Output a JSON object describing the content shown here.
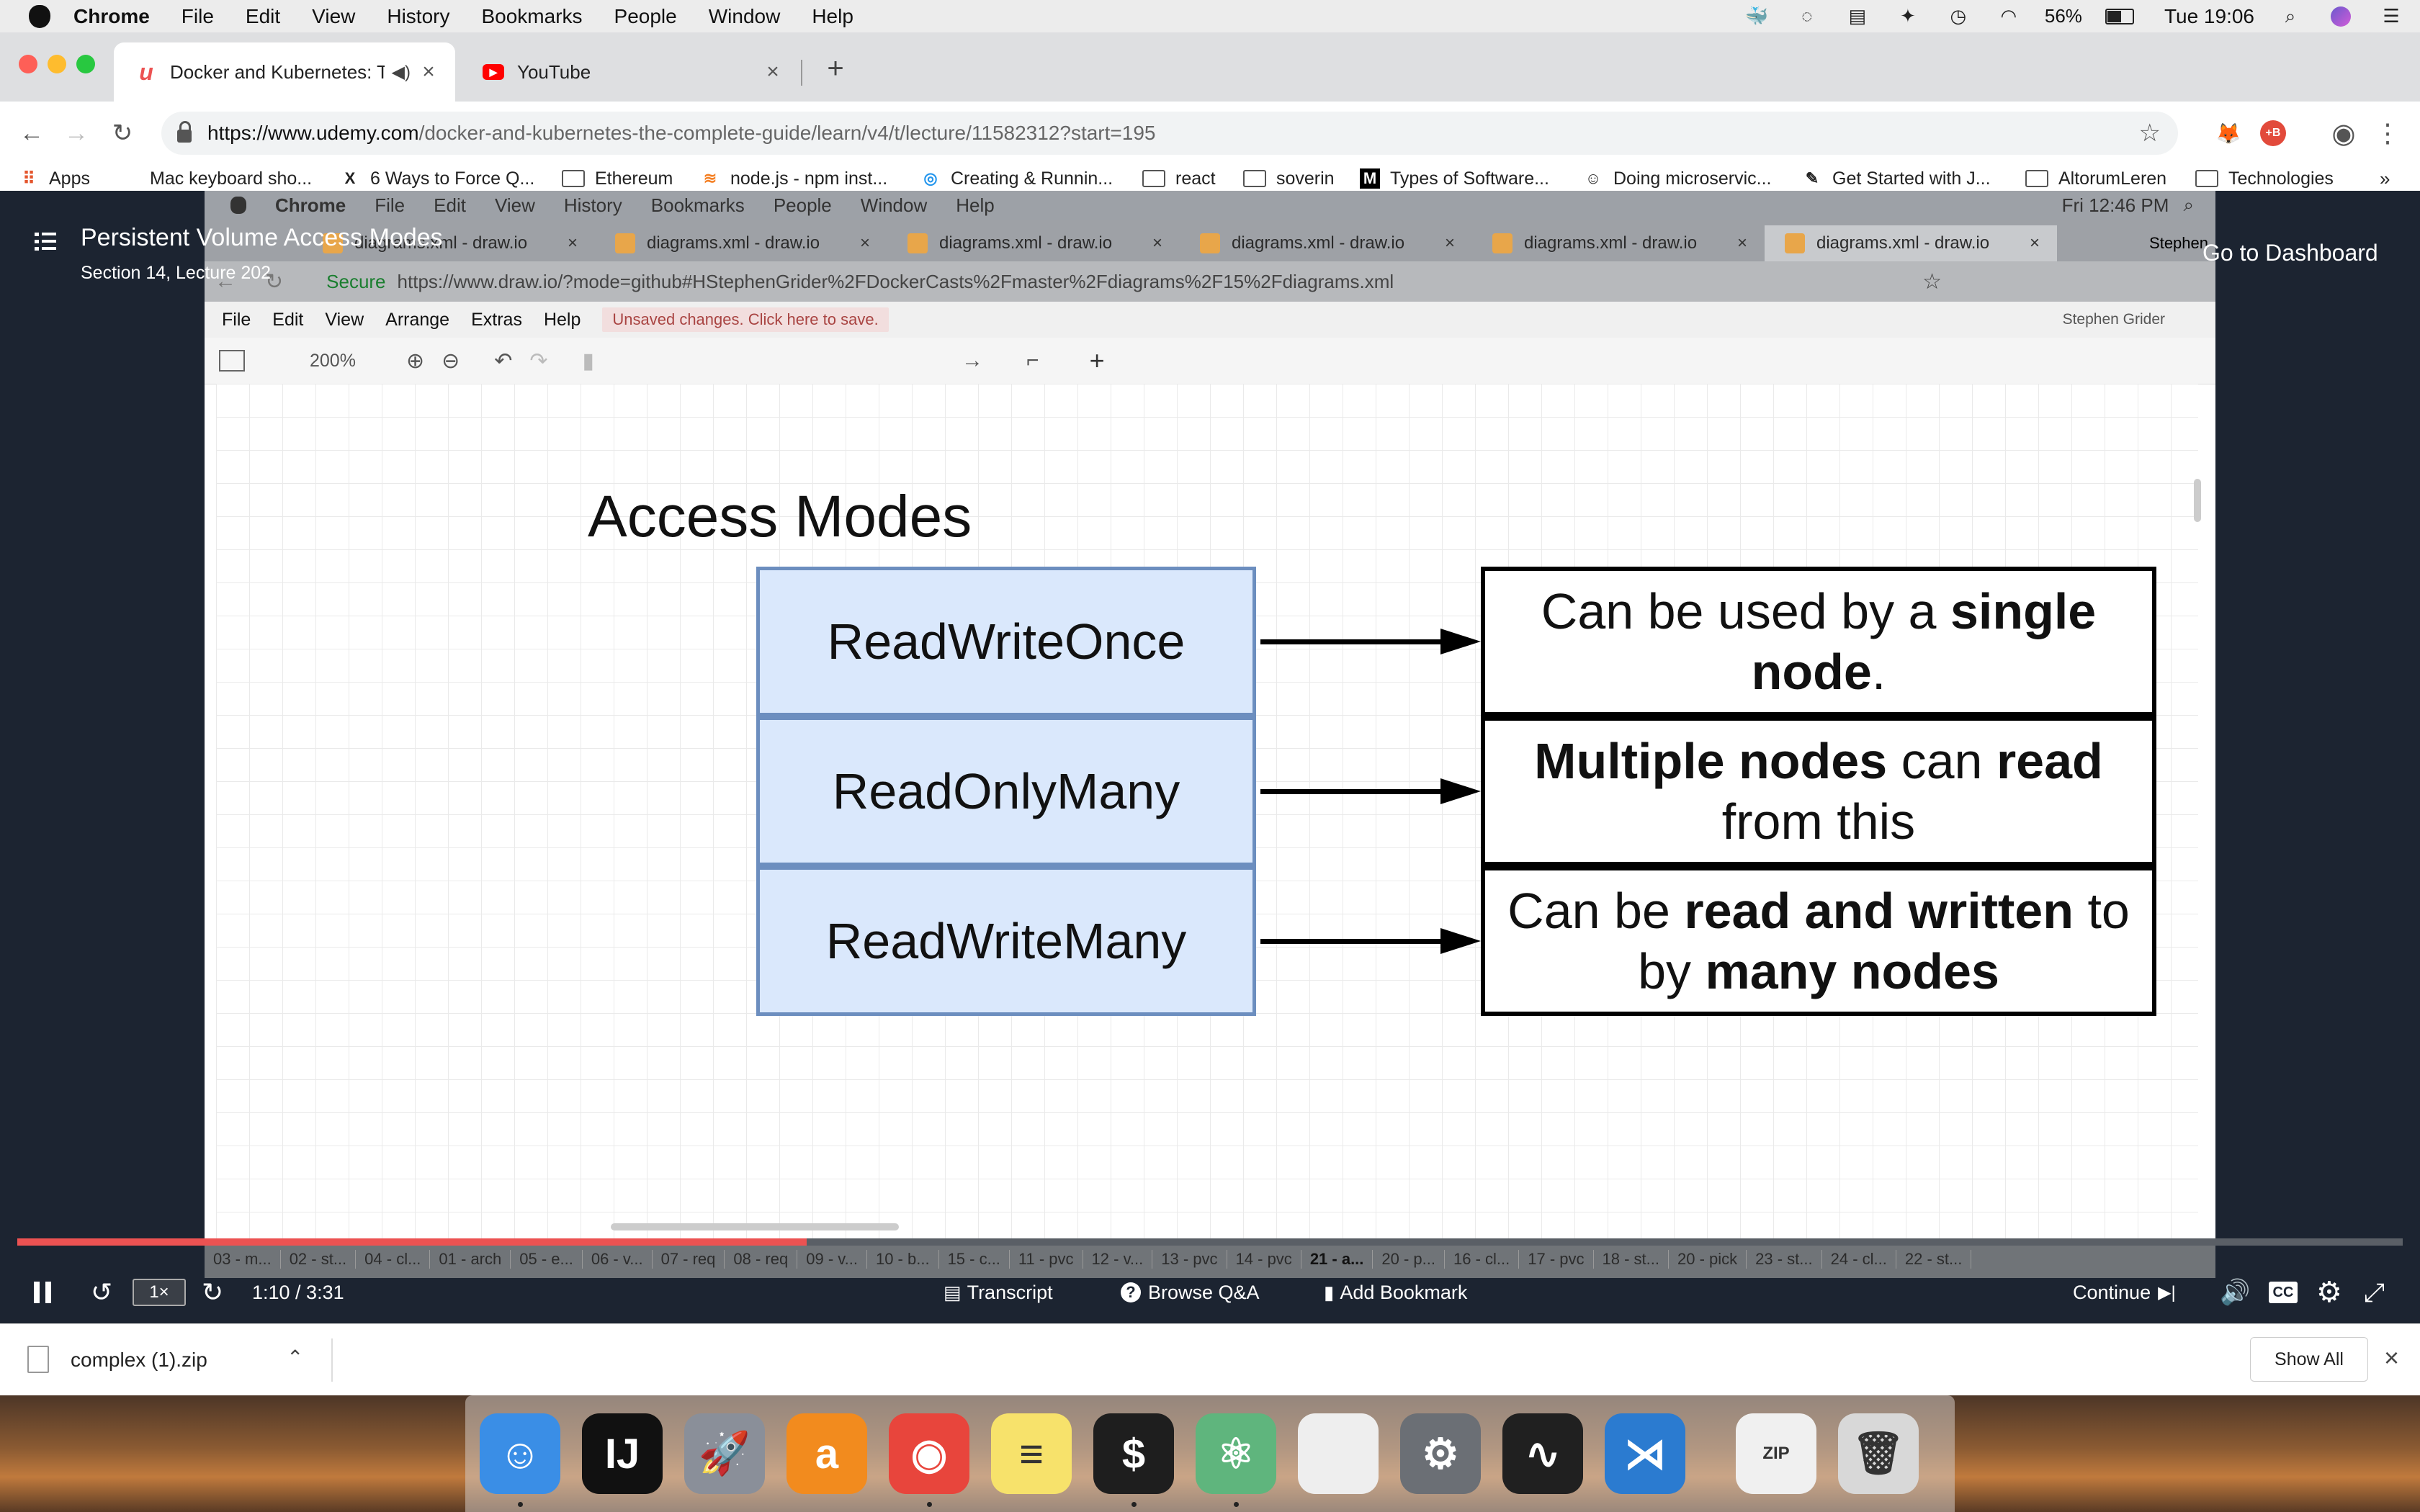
{
  "menubar": {
    "app": "Chrome",
    "items": [
      "File",
      "Edit",
      "View",
      "History",
      "Bookmarks",
      "People",
      "Window",
      "Help"
    ],
    "battery": "56%",
    "clock": "Tue 19:06"
  },
  "tabs": [
    {
      "title": "Docker and Kubernetes: The Complete Guide",
      "favicon": "udemy-icon"
    },
    {
      "title": "YouTube",
      "favicon": "youtube-icon"
    }
  ],
  "omnibox": {
    "host": "https://www.udemy.com",
    "path": "/docker-and-kubernetes-the-complete-guide/learn/v4/t/lecture/11582312?start=195"
  },
  "bookmarks": [
    {
      "label": "Apps",
      "icon": "apps-grid-icon"
    },
    {
      "label": "Mac keyboard sho...",
      "icon": "apple-icon"
    },
    {
      "label": "6 Ways to Force Q...",
      "icon": "x-logo-icon"
    },
    {
      "label": "Ethereum",
      "icon": "folder-icon"
    },
    {
      "label": "node.js - npm inst...",
      "icon": "stack-icon"
    },
    {
      "label": "Creating & Runnin...",
      "icon": "docker-icon"
    },
    {
      "label": "react",
      "icon": "folder-icon"
    },
    {
      "label": "soverin",
      "icon": "folder-icon"
    },
    {
      "label": "Types of Software...",
      "icon": "medium-icon"
    },
    {
      "label": "Doing microservic...",
      "icon": "avatar-icon"
    },
    {
      "label": "Get Started with J...",
      "icon": "edit-icon"
    },
    {
      "label": "AltorumLeren",
      "icon": "folder-icon"
    },
    {
      "label": "Technologies",
      "icon": "folder-icon"
    }
  ],
  "lecture": {
    "title": "Persistent Volume Access Modes",
    "section": "Section 14, Lecture 202",
    "dashboard_link": "Go to Dashboard"
  },
  "video_screen": {
    "menubar": [
      "Chrome",
      "File",
      "Edit",
      "View",
      "History",
      "Bookmarks",
      "People",
      "Window",
      "Help"
    ],
    "clock": "Fri 12:46 PM",
    "tab_title": "diagrams.xml - draw.io",
    "user_tab": "Stephen",
    "secure_label": "Secure",
    "url": "https://www.draw.io/?mode=github#HStephenGrider%2FDockerCasts%2Fmaster%2Fdiagrams%2F15%2Fdiagrams.xml",
    "drawio_menu": [
      "File",
      "Edit",
      "View",
      "Arrange",
      "Extras",
      "Help"
    ],
    "unsaved": "Unsaved changes. Click here to save.",
    "user_name": "Stephen Grider",
    "zoom": "200%"
  },
  "diagram": {
    "title": "Access Modes",
    "rows": [
      {
        "mode": "ReadWriteOnce",
        "parts": [
          [
            "Can be used by a ",
            false
          ],
          [
            "single",
            true
          ],
          [
            " node",
            true
          ],
          [
            ".",
            false
          ]
        ]
      },
      {
        "mode": "ReadOnlyMany",
        "parts": [
          [
            "Multiple nodes",
            true
          ],
          [
            " can ",
            false
          ],
          [
            "read",
            true
          ],
          [
            " from this",
            false
          ]
        ]
      },
      {
        "mode": "ReadWriteMany",
        "parts": [
          [
            "Can be ",
            false
          ],
          [
            "read and written",
            true
          ],
          [
            " to by ",
            false
          ],
          [
            "many nodes",
            true
          ]
        ]
      }
    ]
  },
  "chapters": [
    "03 - m...",
    "02 - st...",
    "04 - cl...",
    "01 - arch",
    "05 - e...",
    "06 - v...",
    "07 - req",
    "08 - req",
    "09 - v...",
    "10 - b...",
    "15 - c...",
    "11 - pvc",
    "12 - v...",
    "13 - pvc",
    "14 - pvc",
    "21 - a...",
    "20 - p...",
    "16 - cl...",
    "17 - pvc",
    "18 - st...",
    "20 - pick",
    "23 - st...",
    "24 - cl...",
    "22 - st..."
  ],
  "player": {
    "speed": "1×",
    "time": "1:10 / 3:31",
    "progress": 0.331,
    "transcript": "Transcript",
    "browse_qa": "Browse Q&A",
    "bookmark": "Add Bookmark",
    "continue": "Continue",
    "cc": "CC"
  },
  "download_shelf": {
    "file": "complex (1).zip",
    "show_all": "Show All"
  },
  "dock": [
    {
      "name": "finder-icon",
      "color": "#3a8ee6",
      "glyph": "☺"
    },
    {
      "name": "intellij-icon",
      "color": "#111111",
      "glyph": "IJ"
    },
    {
      "name": "launchpad-icon",
      "color": "#8a8f99",
      "glyph": "🚀"
    },
    {
      "name": "avast-icon",
      "color": "#f28b1e",
      "glyph": "a"
    },
    {
      "name": "chrome-icon",
      "color": "#e8453c",
      "glyph": "◉"
    },
    {
      "name": "notes-icon",
      "color": "#f7e26b",
      "glyph": "≡"
    },
    {
      "name": "terminal-icon",
      "color": "#1e1e1e",
      "glyph": "$"
    },
    {
      "name": "atom-icon",
      "color": "#5fb57d",
      "glyph": "⚛"
    },
    {
      "name": "textedit-icon",
      "color": "#eeeeee",
      "glyph": ""
    },
    {
      "name": "system-preferences-icon",
      "color": "#6b6f75",
      "glyph": "⚙"
    },
    {
      "name": "activity-monitor-icon",
      "color": "#202020",
      "glyph": "∿"
    },
    {
      "name": "vscode-icon",
      "color": "#2b7bd0",
      "glyph": "⋊"
    },
    {
      "name": "zip-file-icon",
      "color": "#f0f0f0",
      "glyph": "ZIP"
    },
    {
      "name": "trash-icon",
      "color": "#d8d8d8",
      "glyph": "🗑"
    }
  ]
}
